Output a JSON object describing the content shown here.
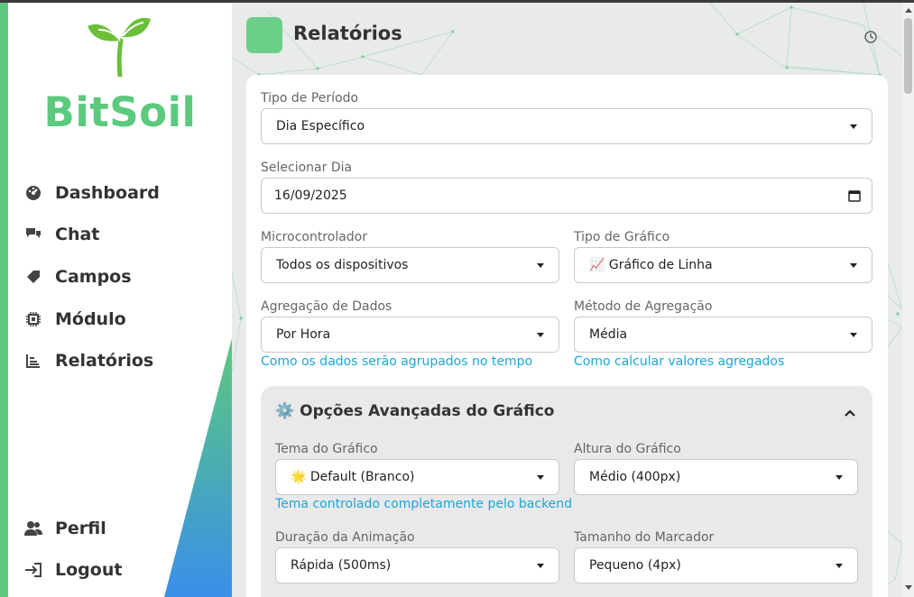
{
  "brand": {
    "name": "BitSoil",
    "accent_color": "#5cc97e"
  },
  "sidebar": {
    "items": [
      {
        "label": "Dashboard",
        "icon": "gauge-icon"
      },
      {
        "label": "Chat",
        "icon": "chat-icon"
      },
      {
        "label": "Campos",
        "icon": "tag-icon"
      },
      {
        "label": "Módulo",
        "icon": "chip-icon"
      },
      {
        "label": "Relatórios",
        "icon": "bar-chart-icon",
        "active": true
      }
    ],
    "bottom": [
      {
        "label": "Perfil",
        "icon": "users-icon"
      },
      {
        "label": "Logout",
        "icon": "logout-icon"
      }
    ]
  },
  "header": {
    "title": "Relatórios",
    "icon": "clock-icon"
  },
  "form": {
    "period_type": {
      "label": "Tipo de Período",
      "value": "Dia Específico"
    },
    "select_day": {
      "label": "Selecionar Dia",
      "value": "16/09/2025"
    },
    "microcontroller": {
      "label": "Microcontrolador",
      "value": "Todos os dispositivos"
    },
    "chart_type": {
      "label": "Tipo de Gráfico",
      "value": "📈 Gráfico de Linha"
    },
    "aggregation": {
      "label": "Agregação de Dados",
      "value": "Por Hora",
      "hint": "Como os dados serão agrupados no tempo"
    },
    "aggregation_method": {
      "label": "Método de Agregação",
      "value": "Média",
      "hint": "Como calcular valores agregados"
    }
  },
  "advanced": {
    "title": "Opções Avançadas do Gráfico",
    "icon": "⚙️",
    "theme": {
      "label": "Tema do Gráfico",
      "value": "🌟 Default (Branco)",
      "hint": "Tema controlado completamente pelo backend"
    },
    "height": {
      "label": "Altura do Gráfico",
      "value": "Médio (400px)"
    },
    "animation": {
      "label": "Duração da Animação",
      "value": "Rápida (500ms)"
    },
    "marker": {
      "label": "Tamanho do Marcador",
      "value": "Pequeno (4px)"
    }
  },
  "colors": {
    "hint": "#1aa7d9",
    "header_square": "#6bcf8a",
    "gradient_start": "#5cc97e",
    "gradient_end": "#3a8fe8"
  }
}
